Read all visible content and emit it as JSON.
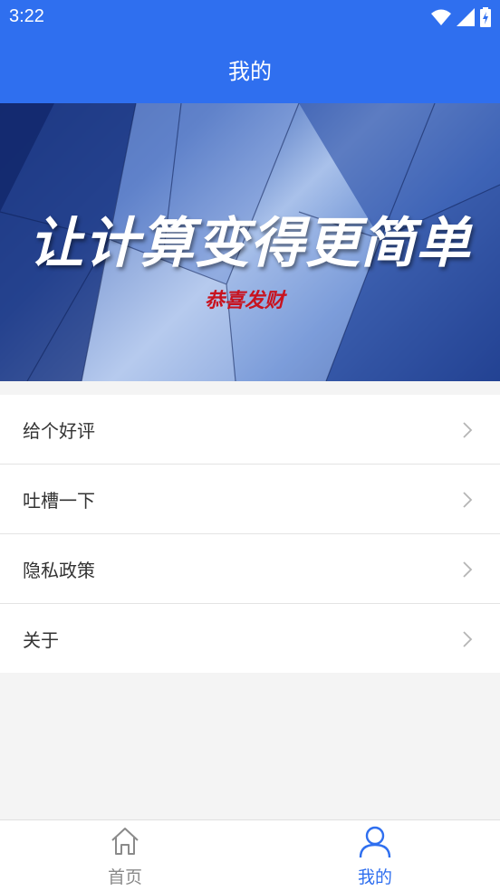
{
  "status_bar": {
    "time": "3:22"
  },
  "app_bar": {
    "title": "我的"
  },
  "banner": {
    "title": "让计算变得更简单",
    "subtitle": "恭喜发财"
  },
  "menu": [
    {
      "label": "给个好评"
    },
    {
      "label": "吐槽一下"
    },
    {
      "label": "隐私政策"
    },
    {
      "label": "关于"
    }
  ],
  "bottom_nav": {
    "home_label": "首页",
    "mine_label": "我的"
  },
  "colors": {
    "primary": "#2f6fef",
    "active_tab": "#2f6fef",
    "inactive_tab": "#8a8a8a",
    "subtitle_red": "#c8131f"
  },
  "icons": {
    "wifi": "wifi-icon",
    "signal": "signal-icon",
    "battery": "battery-icon",
    "chevron": "chevron-right-icon",
    "home": "home-icon",
    "profile": "person-icon"
  }
}
